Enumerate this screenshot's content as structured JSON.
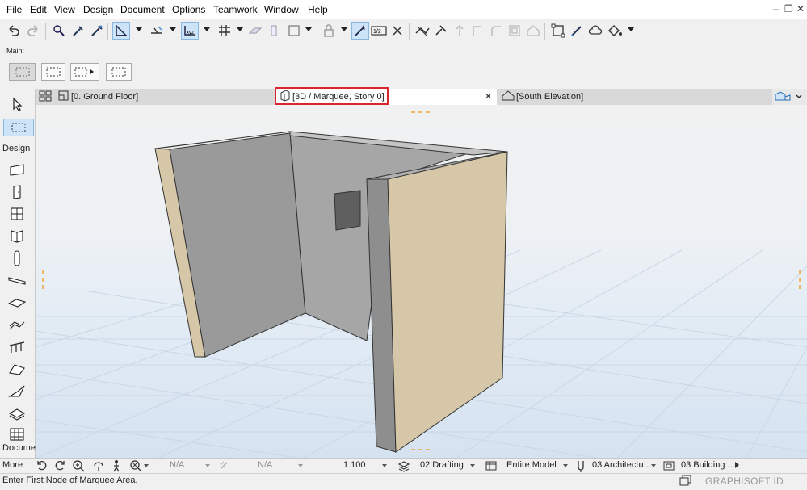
{
  "menu": [
    "File",
    "Edit",
    "View",
    "Design",
    "Document",
    "Options",
    "Teamwork",
    "Window",
    "Help"
  ],
  "window_controls": {
    "minimize": "–",
    "restore": "❐",
    "close": "✕"
  },
  "main_label": "Main:",
  "tabs": {
    "ground_floor": "[0. Ground Floor]",
    "marquee": "[3D / Marquee, Story 0]",
    "south_elevation": "[South Elevation]",
    "close_glyph": "✕"
  },
  "toolbox": {
    "design_label": "Design",
    "document_label": "Docume",
    "more_label": "More"
  },
  "bottom_bar": {
    "angle_value": "N/A",
    "distance_value": "N/A",
    "scale": "1:100",
    "layer_combo": "02 Drafting",
    "model_view": "Entire Model",
    "pen_set": "03 Architectu...",
    "mvo": "03 Building ..."
  },
  "status": {
    "message": "Enter First Node of Marquee Area.",
    "brand": "GRAPHISOFT ID"
  },
  "colors": {
    "highlight_box": "#d9262c",
    "wall_face_front": "#d6c7a8",
    "wall_gray": "#9e9e9e",
    "active_tool": "#cde3f7",
    "grid_line": "#c9d7e6"
  }
}
